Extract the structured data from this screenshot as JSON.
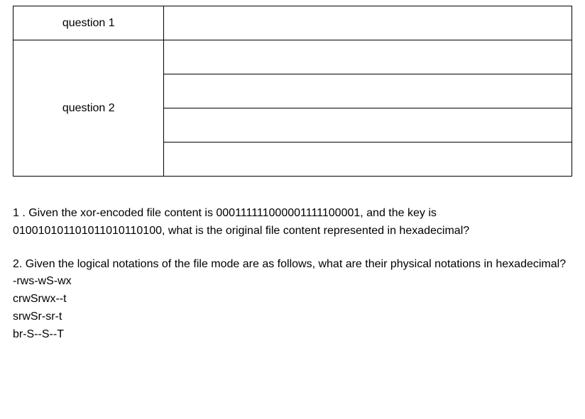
{
  "table": {
    "rows": {
      "q1_label": "question 1",
      "q2_label": "question 2"
    }
  },
  "questions": {
    "q1_text": "1 . Given the xor-encoded file content is 000111111000001111100001, and the key is 010010101101011010110100, what is the original file content represented in hexadecimal?",
    "q2_prompt": "2. Given the logical notations of the file mode are as follows, what are their physical notations in hexadecimal?",
    "q2_modes": [
      "-rws-wS-wx",
      "crwSrwx--t",
      "srwSr-sr-t",
      "br-S--S--T"
    ]
  }
}
